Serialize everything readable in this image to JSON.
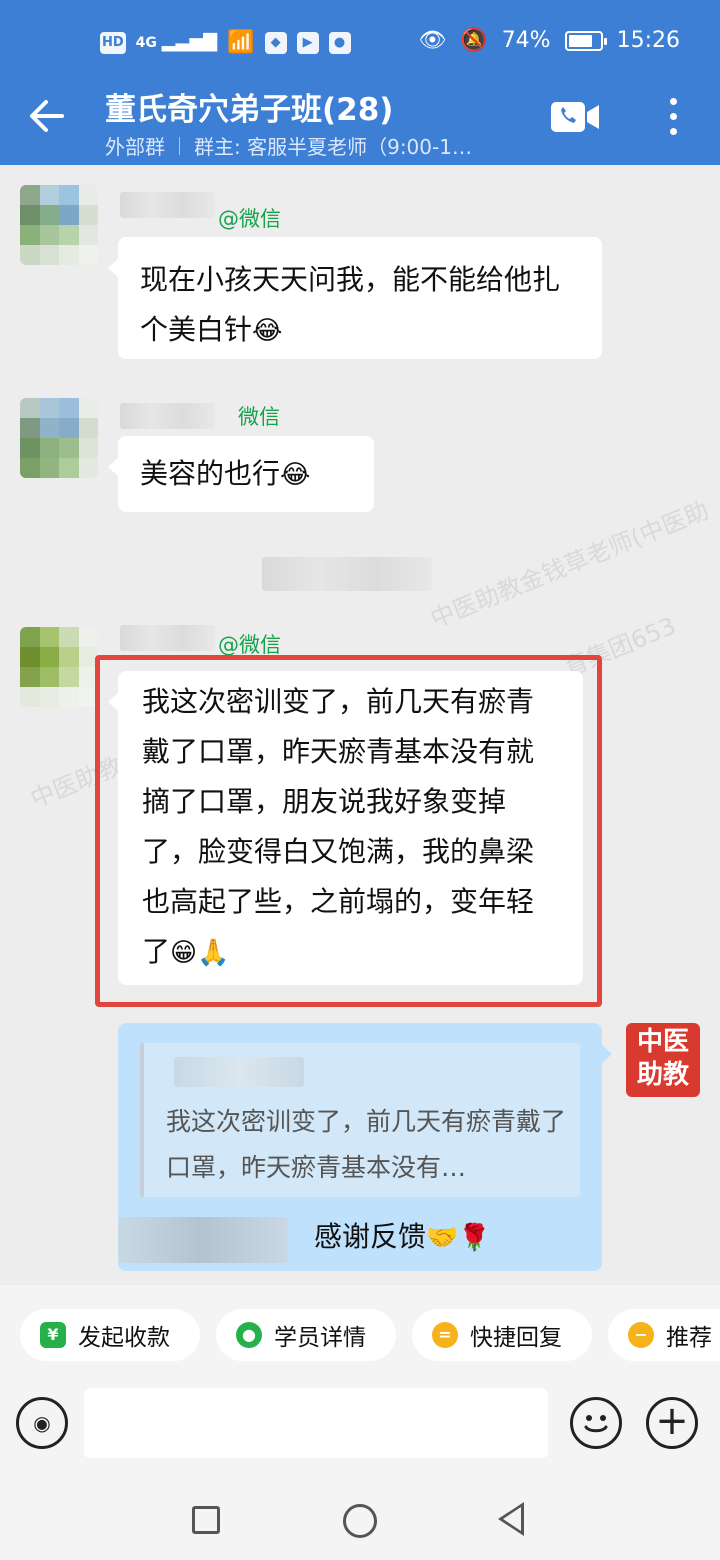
{
  "status_bar": {
    "network_label": "HD",
    "signal_label": "4G",
    "battery_pct": "74%",
    "time": "15:26"
  },
  "header": {
    "title": "董氏奇穴弟子班(28)",
    "group_type": "外部群",
    "owner": "群主: 客服半夏老师（9:00-1…"
  },
  "messages": [
    {
      "source": "@微信",
      "text": "现在小孩天天问我，能不能给他扎个美白针",
      "emoji": "😂"
    },
    {
      "source": "微信",
      "text": "美容的也行",
      "emoji": "😂"
    },
    {
      "source": "@微信",
      "text": "我这次密训变了，前几天有瘀青戴了口罩，昨天瘀青基本没有就摘了口罩，朋友说我好象变掉了，脸变得白又饱满，我的鼻梁也高起了些，之前塌的，变年轻了",
      "emoji": "😁🙏"
    }
  ],
  "outgoing": {
    "quote_text": "我这次密训变了，前几天有瘀青戴了口罩，昨天瘀青基本没有…",
    "reply_text": "感谢反馈",
    "reply_emoji": "🤝🌹"
  },
  "logo": {
    "line1": "中医",
    "line2": "助教"
  },
  "watermarks": [
    "中医助教金钱草老师(中医助",
    "育集团653",
    "中医助教金钱草老师(中医助"
  ],
  "chips": [
    {
      "label": "发起收款",
      "icon": "yuan-icon",
      "color": "#27b04a"
    },
    {
      "label": "学员详情",
      "icon": "user-icon",
      "color": "#27b04a"
    },
    {
      "label": "快捷回复",
      "icon": "reply-icon",
      "color": "#f5b21a"
    },
    {
      "label": "推荐",
      "icon": "recommend-icon",
      "color": "#f5b21a"
    }
  ],
  "input": {
    "placeholder": ""
  },
  "colors": {
    "header": "#3d7fd4",
    "highlight": "#e2453c",
    "outgoing": "#bfe1fb",
    "source": "#16a34a"
  }
}
